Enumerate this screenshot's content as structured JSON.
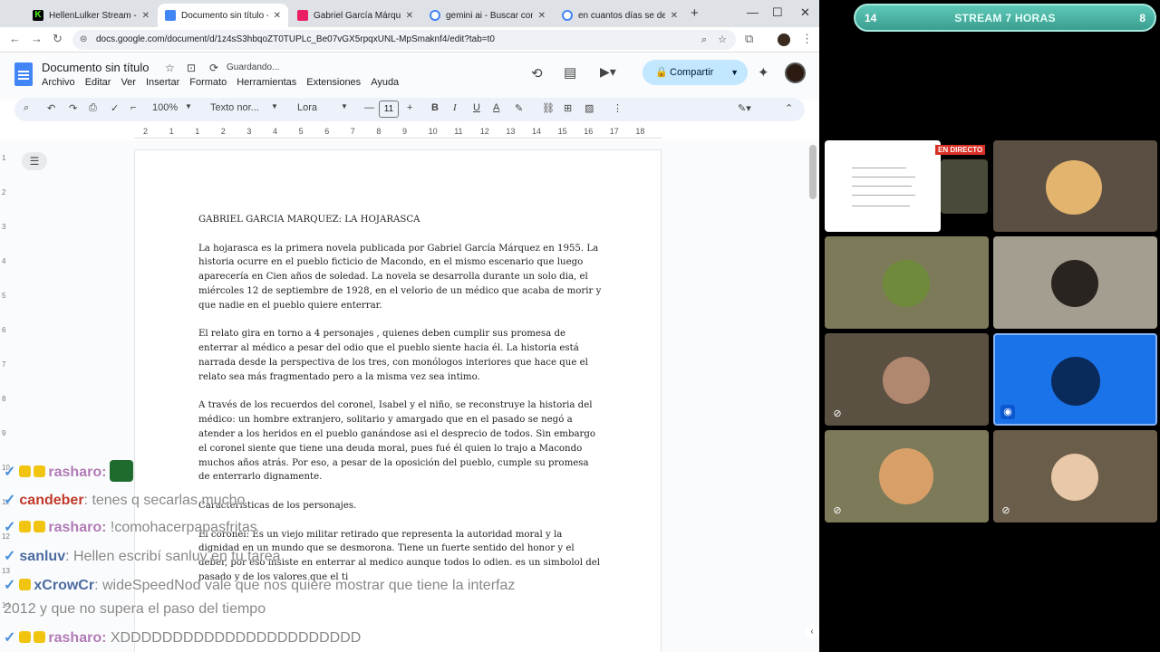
{
  "browser": {
    "tabs": [
      {
        "title": "HellenLulker Stream - Watc",
        "icon": "kick-icon",
        "color": "#53fc18"
      },
      {
        "title": "Documento sin título - Doc",
        "icon": "docs-icon",
        "color": "#4285f4"
      },
      {
        "title": "Gabriel García Márquez: La",
        "icon": "bookmark-icon",
        "color": "#e91e63"
      },
      {
        "title": "gemini ai - Buscar con Goo",
        "icon": "google-icon",
        "color": "#ffffff"
      },
      {
        "title": "en cuantos días se desarroll",
        "icon": "google-icon",
        "color": "#ffffff"
      }
    ],
    "url": "docs.google.com/document/d/1z4sS3hbqoZT0TUPLc_Be07vGX5rpqxUNL-MpSmaknf4/edit?tab=t0"
  },
  "docs": {
    "title": "Documento sin título",
    "status": "Guardando...",
    "menus": [
      "Archivo",
      "Editar",
      "Ver",
      "Insertar",
      "Formato",
      "Herramientas",
      "Extensiones",
      "Ayuda"
    ],
    "share_label": "Compartir",
    "toolbar": {
      "zoom": "100%",
      "style": "Texto nor...",
      "font": "Lora",
      "size": "11"
    },
    "ruler": [
      "2",
      "1",
      "1",
      "2",
      "3",
      "4",
      "5",
      "6",
      "7",
      "8",
      "9",
      "10",
      "11",
      "12",
      "13",
      "14",
      "15",
      "16",
      "17",
      "18"
    ],
    "vruler": [
      "1",
      "2",
      "3",
      "4",
      "5",
      "6",
      "7",
      "8",
      "9",
      "10",
      "11",
      "12",
      "13",
      "14"
    ],
    "heading": "GABRIEL GARCIA MARQUEZ: LA HOJARASCA",
    "paragraphs": [
      "La hojarasca es la primera novela publicada por Gabriel García Márquez en 1955. La historia ocurre en el pueblo ficticio de Macondo, en el mismo escenario que luego aparecería en Cien años de soledad. La novela se desarrolla durante un solo dia, el miércoles 12 de septiembre de 1928, en el velorio de un médico que acaba de morir y que nadie en el pueblo quiere enterrar.",
      "El relato gira en torno a 4 personajes , quienes deben cumplir sus promesa de enterrar al médico a pesar del odio que el pueblo siente hacia él. La historia está narrada desde la perspectiva de los tres, con monólogos interiores que hace que el relato sea más fragmentado pero a la misma vez sea intimo.",
      "A través de los recuerdos del coronel, Isabel y el niño, se reconstruye la historia del médico: un hombre extranjero, solitario y amargado que en el pasado se negó a atender a los heridos en el pueblo ganándose asi el desprecio de todos. Sin embargo el coronel siente que tiene una deuda moral, pues fué él quien lo trajo a Macondo muchos años atrás. Por eso, a pesar de la oposición del pueblo, cumple su promesa de enterrarlo dignamente.",
      "Caracteristicas de los personajes.",
      "El coronel: Es un viejo militar retirado que representa la autoridad moral y la dignidad en un mundo que se desmorona. Tiene un fuerte sentido del honor y el deber, por eso insiste en enterrar al medico aunque todos lo odien. es un simbolol del pasado y de los valores que el ti"
    ]
  },
  "chat": [
    {
      "user": "rasharo:",
      "msg": "",
      "style": "u"
    },
    {
      "user": "candeber",
      "msg": ": tenes q secarlas mucho",
      "style": "u2"
    },
    {
      "user": "rasharo:",
      "msg": " !comohacerpapasfritas",
      "style": "u"
    },
    {
      "user": "sanluv",
      "msg": ": Hellen escribí sanluv en tu tarea",
      "style": "u3"
    },
    {
      "user": "xCrowCr",
      "msg": ": wideSpeedNod vale que nos quiere mostrar que tiene la interfaz",
      "style": "u3"
    },
    {
      "user": "",
      "msg": "2012 y que no supera el paso del tiempo",
      "style": "m"
    },
    {
      "user": "rasharo:",
      "msg": " XDDDDDDDDDDDDDDDDDDDDDDD",
      "style": "u"
    }
  ],
  "stream": {
    "left_num": "14",
    "title": "STREAM 7 HORAS",
    "right_num": "8",
    "live_label": "EN DIRECTO"
  },
  "colors": {
    "accent": "#c2e7ff",
    "speaking": "#1a73e8",
    "tile_olive": "#7d7a5a"
  }
}
